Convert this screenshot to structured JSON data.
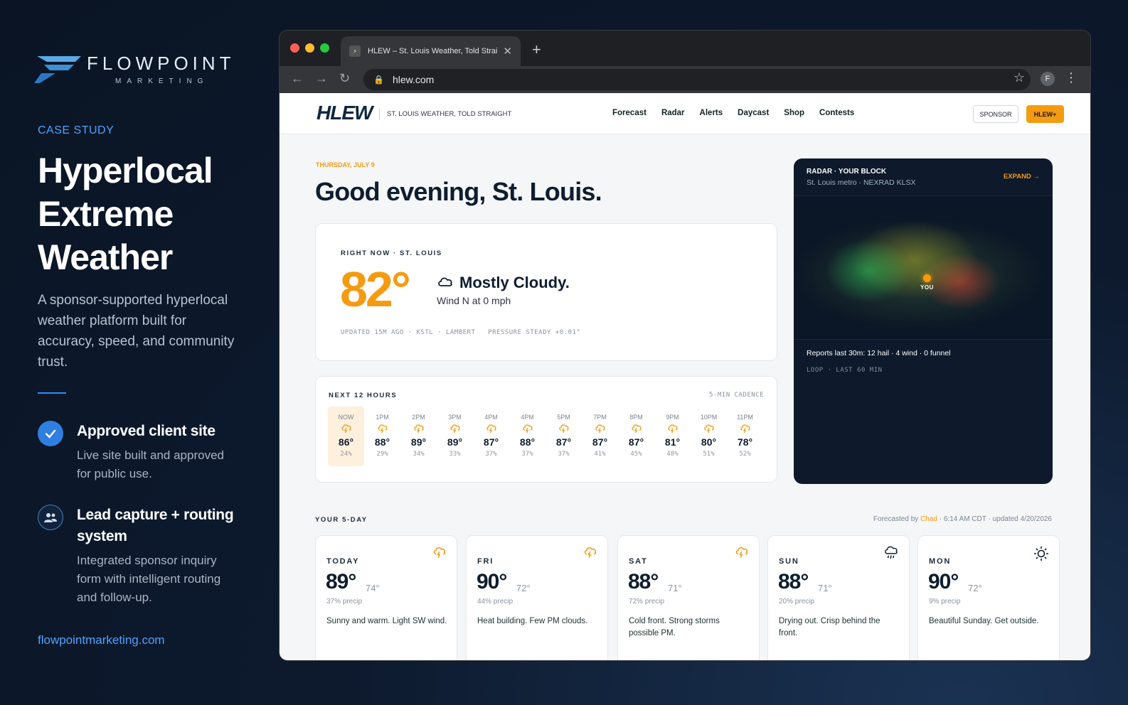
{
  "brand": {
    "name": "FLOWPOINT",
    "sub": "MARKETING"
  },
  "case": {
    "eyebrow": "CASE STUDY",
    "title_l1": "Hyperlocal",
    "title_l2": "Extreme",
    "title_l3": "Weather",
    "description": "A sponsor-supported hyperlocal weather platform built for accuracy, speed, and community trust.",
    "features": [
      {
        "title": "Approved client site",
        "text": "Live site built and approved for public use."
      },
      {
        "title": "Lead capture + routing system",
        "text": "Integrated sponsor inquiry form with intelligent routing and follow-up."
      }
    ],
    "link": "flowpointmarketing.com"
  },
  "browser": {
    "tab_title": "HLEW – St. Louis Weather, Told Straight",
    "url": "hlew.com",
    "avatar": "F"
  },
  "site": {
    "logo": "HLEW",
    "tagline": "ST. LOUIS WEATHER, TOLD STRAIGHT",
    "menu": [
      "Forecast",
      "Radar",
      "Alerts",
      "Daycast",
      "Shop",
      "Contests"
    ],
    "sponsor_btn": "SPONSOR",
    "plus_btn": "HLEW+",
    "date": "THURSDAY, JULY 9",
    "greeting": "Good evening, St. Louis."
  },
  "now": {
    "caption": "RIGHT NOW · ST. LOUIS",
    "temp": "82°",
    "condition": "Mostly Cloudy.",
    "wind": "Wind N at 0 mph",
    "meta": "UPDATED 15M AGO · KSTL · LAMBERT   PRESSURE STEADY +0.01\""
  },
  "hourly": {
    "caption": "NEXT 12 HOURS",
    "cadence": "5-MIN CADENCE",
    "hours": [
      {
        "label": "NOW",
        "temp": "86°",
        "precip": "24%"
      },
      {
        "label": "1PM",
        "temp": "88°",
        "precip": "29%"
      },
      {
        "label": "2PM",
        "temp": "89°",
        "precip": "34%"
      },
      {
        "label": "3PM",
        "temp": "89°",
        "precip": "33%"
      },
      {
        "label": "4PM",
        "temp": "87°",
        "precip": "37%"
      },
      {
        "label": "4PM",
        "temp": "88°",
        "precip": "37%"
      },
      {
        "label": "5PM",
        "temp": "87°",
        "precip": "37%"
      },
      {
        "label": "7PM",
        "temp": "87°",
        "precip": "41%"
      },
      {
        "label": "8PM",
        "temp": "87°",
        "precip": "45%"
      },
      {
        "label": "9PM",
        "temp": "81°",
        "precip": "48%"
      },
      {
        "label": "10PM",
        "temp": "80°",
        "precip": "51%"
      },
      {
        "label": "11PM",
        "temp": "78°",
        "precip": "52%"
      }
    ]
  },
  "radar": {
    "title": "RADAR · YOUR BLOCK",
    "subtitle": "St. Louis metro · NEXRAD KLSX",
    "expand": "EXPAND →",
    "you": "YOU",
    "reports": "Reports last 30m: 12 hail · 4 wind · 0 funnel",
    "loop": "LOOP · LAST 60 MIN"
  },
  "fiveday": {
    "caption": "YOUR 5-DAY",
    "forecasted_pre": "Forecasted by",
    "forecaster": "Chad",
    "forecasted_post": "· 6:14 AM CDT · updated 4/20/2026",
    "days": [
      {
        "name": "TODAY",
        "hi": "89°",
        "lo": "74°",
        "precip": "37% precip",
        "text": "Sunny and warm. Light SW wind.",
        "icon": "storm-icon"
      },
      {
        "name": "FRI",
        "hi": "90°",
        "lo": "72°",
        "precip": "44% precip",
        "text": "Heat building. Few PM clouds.",
        "icon": "storm-icon"
      },
      {
        "name": "SAT",
        "hi": "88°",
        "lo": "71°",
        "precip": "72% precip",
        "text": "Cold front. Strong storms possible PM.",
        "icon": "storm-icon"
      },
      {
        "name": "SUN",
        "hi": "88°",
        "lo": "71°",
        "precip": "20% precip",
        "text": "Drying out. Crisp behind the front.",
        "icon": "rain-icon"
      },
      {
        "name": "MON",
        "hi": "90°",
        "lo": "72°",
        "precip": "9% precip",
        "text": "Beautiful Sunday. Get outside.",
        "icon": "sun-icon"
      }
    ]
  },
  "colors": {
    "accent": "#f59b12",
    "blue": "#4da3ff",
    "navy": "#0f1d30"
  }
}
